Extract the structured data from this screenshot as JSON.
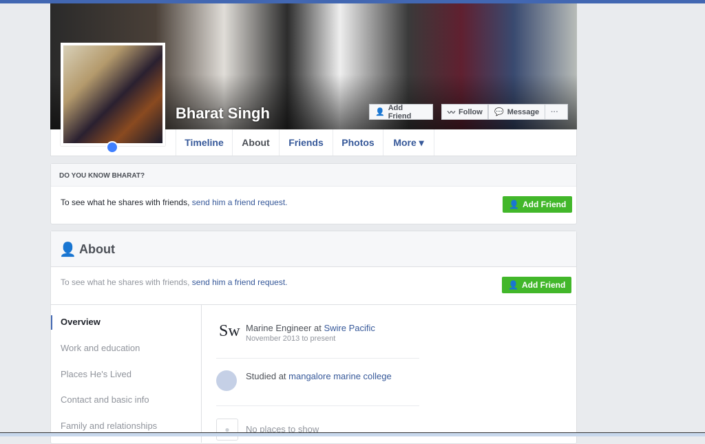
{
  "profile": {
    "name": "Bharat Singh"
  },
  "cover_buttons": {
    "add_friend": "Add Friend",
    "follow": "Follow",
    "message": "Message",
    "more": "···"
  },
  "tabs": [
    {
      "label": "Timeline"
    },
    {
      "label": "About"
    },
    {
      "label": "Friends"
    },
    {
      "label": "Photos"
    },
    {
      "label": "More ▾"
    }
  ],
  "know_box": {
    "title": "DO YOU KNOW BHARAT?",
    "text": "To see what he shares with friends, ",
    "link": "send him a friend request.",
    "button": "Add Friend"
  },
  "about": {
    "title": "About",
    "text": "To see what he shares with friends, ",
    "link": "send him a friend request.",
    "button": "Add Friend",
    "sidebar": [
      {
        "label": "Overview"
      },
      {
        "label": "Work and education"
      },
      {
        "label": "Places He's Lived"
      },
      {
        "label": "Contact and basic info"
      },
      {
        "label": "Family and relationships"
      }
    ],
    "work": {
      "logo": "Sw",
      "role": "Marine Engineer at ",
      "company": "Swire Pacific",
      "dates": "November 2013 to present"
    },
    "education": {
      "text": "Studied at ",
      "school": "mangalore marine college"
    },
    "places": {
      "text": "No places to show"
    }
  }
}
